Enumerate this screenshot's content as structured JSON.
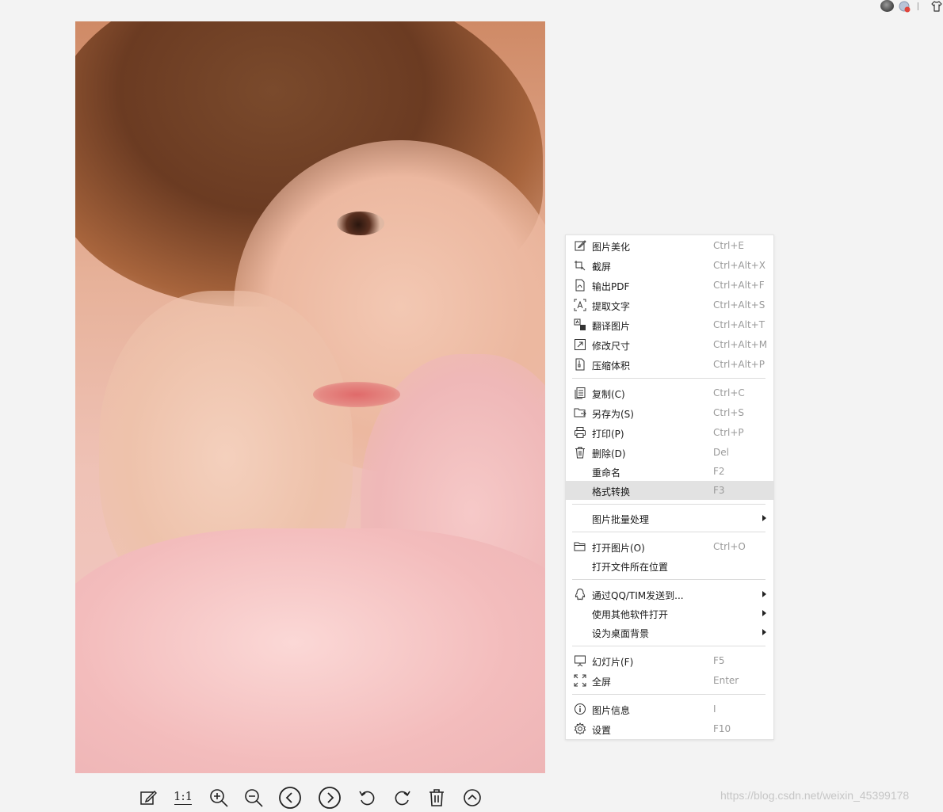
{
  "context_menu": {
    "items": [
      {
        "label": "图片美化",
        "shortcut": "Ctrl+E",
        "icon": "edit-icon"
      },
      {
        "label": "截屏",
        "shortcut": "Ctrl+Alt+X",
        "icon": "screenshot-icon"
      },
      {
        "label": "输出PDF",
        "shortcut": "Ctrl+Alt+F",
        "icon": "pdf-icon"
      },
      {
        "label": "提取文字",
        "shortcut": "Ctrl+Alt+S",
        "icon": "ocr-icon"
      },
      {
        "label": "翻译图片",
        "shortcut": "Ctrl+Alt+T",
        "icon": "translate-icon"
      },
      {
        "label": "修改尺寸",
        "shortcut": "Ctrl+Alt+M",
        "icon": "resize-icon"
      },
      {
        "label": "压缩体积",
        "shortcut": "Ctrl+Alt+P",
        "icon": "compress-icon"
      },
      {
        "label": "复制(C)",
        "shortcut": "Ctrl+C",
        "icon": "copy-icon"
      },
      {
        "label": "另存为(S)",
        "shortcut": "Ctrl+S",
        "icon": "save-as-icon"
      },
      {
        "label": "打印(P)",
        "shortcut": "Ctrl+P",
        "icon": "print-icon"
      },
      {
        "label": "删除(D)",
        "shortcut": "Del",
        "icon": "trash-icon"
      },
      {
        "label": "重命名",
        "shortcut": "F2",
        "icon": ""
      },
      {
        "label": "格式转换",
        "shortcut": "F3",
        "icon": "",
        "highlighted": true
      },
      {
        "label": "图片批量处理",
        "shortcut": "",
        "icon": "",
        "submenu": true
      },
      {
        "label": "打开图片(O)",
        "shortcut": "Ctrl+O",
        "icon": "folder-icon"
      },
      {
        "label": "打开文件所在位置",
        "shortcut": "",
        "icon": ""
      },
      {
        "label": "通过QQ/TIM发送到...",
        "shortcut": "",
        "icon": "qq-icon",
        "submenu": true
      },
      {
        "label": "使用其他软件打开",
        "shortcut": "",
        "icon": "",
        "submenu": true
      },
      {
        "label": "设为桌面背景",
        "shortcut": "",
        "icon": "",
        "submenu": true
      },
      {
        "label": "幻灯片(F)",
        "shortcut": "F5",
        "icon": "slideshow-icon"
      },
      {
        "label": "全屏",
        "shortcut": "Enter",
        "icon": "fullscreen-icon"
      },
      {
        "label": "图片信息",
        "shortcut": "I",
        "icon": "info-icon"
      },
      {
        "label": "设置",
        "shortcut": "F10",
        "icon": "gear-icon"
      }
    ]
  },
  "toolbar": {
    "ratio_label": "1:1",
    "buttons": [
      "edit-icon",
      "actual-size-icon",
      "zoom-in-icon",
      "zoom-out-icon",
      "previous-icon",
      "next-icon",
      "rotate-left-icon",
      "rotate-right-icon",
      "trash-icon",
      "expand-up-icon"
    ]
  },
  "watermark": "https://blog.csdn.net/weixin_45399178",
  "photo": {
    "subject": "portrait photo"
  }
}
